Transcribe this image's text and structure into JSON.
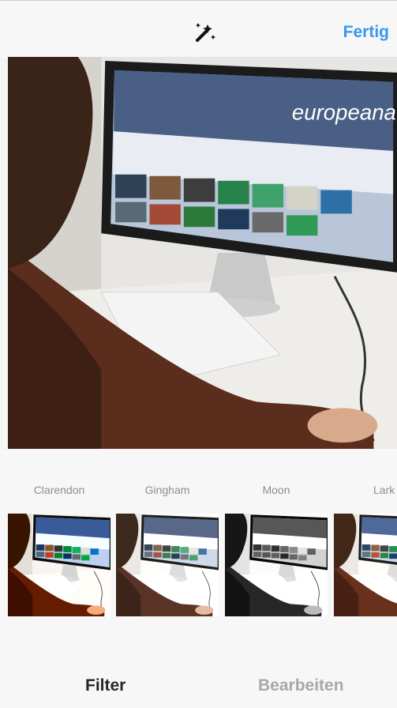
{
  "header": {
    "wand_icon": "magic-wand-icon",
    "done_label": "Fertig",
    "accent": "#3897f0"
  },
  "photo": {
    "screen_logo_text": "europeana",
    "description_icon": "photo"
  },
  "filters": [
    {
      "name": "Clarendon"
    },
    {
      "name": "Gingham"
    },
    {
      "name": "Moon"
    },
    {
      "name": "Lark"
    }
  ],
  "tabs": {
    "filter_label": "Filter",
    "edit_label": "Bearbeiten"
  }
}
